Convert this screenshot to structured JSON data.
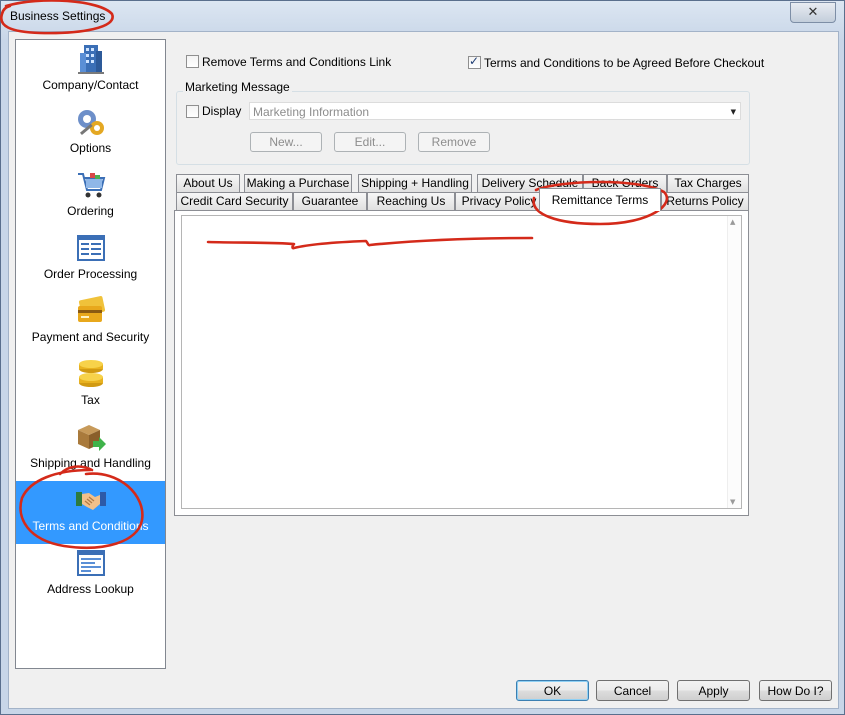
{
  "window": {
    "title": "Business Settings",
    "close_glyph": "✕"
  },
  "sidebar": {
    "items": [
      {
        "label": "Company/Contact",
        "icon": "building-icon"
      },
      {
        "label": "Options",
        "icon": "gears-icon"
      },
      {
        "label": "Ordering",
        "icon": "shopping-cart-icon"
      },
      {
        "label": "Order Processing",
        "icon": "form-icon"
      },
      {
        "label": "Payment and Security",
        "icon": "credit-card-icon"
      },
      {
        "label": "Tax",
        "icon": "coins-icon"
      },
      {
        "label": "Shipping and Handling",
        "icon": "box-arrow-icon"
      },
      {
        "label": "Terms and Conditions",
        "icon": "handshake-icon",
        "selected": true
      },
      {
        "label": "Address Lookup",
        "icon": "address-form-icon"
      }
    ]
  },
  "options": {
    "remove_link_label": "Remove Terms and Conditions Link",
    "remove_link_checked": false,
    "agree_before_checkout_label": "Terms and Conditions to be Agreed Before Checkout",
    "agree_before_checkout_checked": true
  },
  "marketing": {
    "group_title": "Marketing Message",
    "display_label": "Display",
    "display_checked": false,
    "combo_value": "Marketing Information",
    "buttons": {
      "new": "New...",
      "edit": "Edit...",
      "remove": "Remove"
    }
  },
  "tabs": {
    "row_back": [
      "About Us",
      "Making a Purchase",
      "Shipping + Handling",
      "Delivery Schedule",
      "Back Orders",
      "Tax Charges"
    ],
    "row_front": [
      "Credit Card Security",
      "Guarantee",
      "Reaching Us",
      "Privacy Policy",
      "Remittance Terms",
      "Returns Policy"
    ],
    "active": "Remittance Terms"
  },
  "editor": {
    "content": ""
  },
  "footer": {
    "ok": "OK",
    "cancel": "Cancel",
    "apply": "Apply",
    "help": "How Do I?"
  },
  "colors": {
    "selection": "#3399ff",
    "annotation": "#d42a1a"
  }
}
